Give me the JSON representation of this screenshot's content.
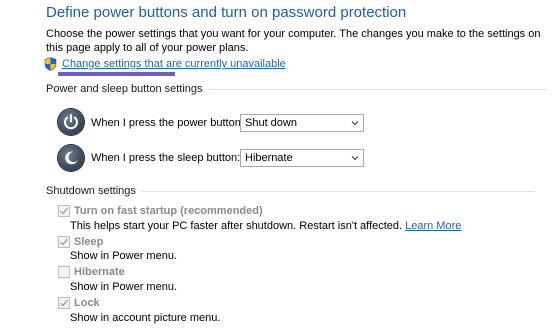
{
  "page": {
    "title": "Define power buttons and turn on password protection",
    "description": "Choose the power settings that you want for your computer. The changes you make to the settings on this page apply to all of your power plans.",
    "change_link": "Change settings that are currently unavailable"
  },
  "power_sleep": {
    "heading": "Power and sleep button settings",
    "power_label": "When I press the power button:",
    "power_value": "Shut down",
    "sleep_label": "When I press the sleep button:",
    "sleep_value": "Hibernate"
  },
  "shutdown": {
    "heading": "Shutdown settings",
    "items": [
      {
        "label": "Turn on fast startup (recommended)",
        "checked": true,
        "description": "This helps start your PC faster after shutdown. Restart isn't affected.",
        "link": "Learn More"
      },
      {
        "label": "Sleep",
        "checked": true,
        "description": "Show in Power menu."
      },
      {
        "label": "Hibernate",
        "checked": false,
        "description": "Show in Power menu."
      },
      {
        "label": "Lock",
        "checked": true,
        "description": "Show in account picture menu."
      }
    ]
  },
  "icons": {
    "shield": "uac-shield-icon",
    "power": "power-button-icon",
    "sleep": "sleep-moon-icon",
    "dropdown": "chevron-down-icon",
    "check": "checkmark-icon"
  },
  "colors": {
    "title": "#1e5fa6",
    "link": "#1c67b8",
    "highlight_bar": "#6c5fbf",
    "disabled_text": "#8a8a8a"
  }
}
